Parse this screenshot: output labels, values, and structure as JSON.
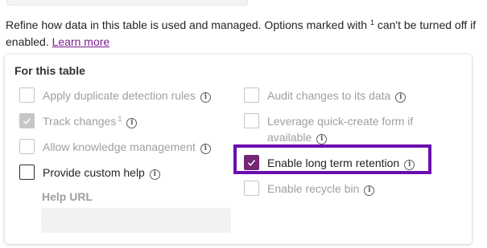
{
  "description": {
    "text_before": "Refine how data in this table is used and managed. Options marked with ",
    "superscript": "1",
    "text_after": " can't be turned off if enabled. ",
    "link_label": "Learn more"
  },
  "section": {
    "title": "For this table",
    "left_options": [
      {
        "label": "Apply duplicate detection rules",
        "checked": false,
        "disabled": true,
        "superscript": ""
      },
      {
        "label": "Track changes",
        "checked": true,
        "disabled": true,
        "superscript": "1"
      },
      {
        "label": "Allow knowledge management",
        "checked": false,
        "disabled": true,
        "superscript": ""
      },
      {
        "label": "Provide custom help",
        "checked": false,
        "disabled": false,
        "superscript": ""
      }
    ],
    "right_options": [
      {
        "label": "Audit changes to its data",
        "checked": false,
        "disabled": true
      },
      {
        "label": "Leverage quick-create form if available",
        "checked": false,
        "disabled": true
      },
      {
        "label": "Enable long term retention",
        "checked": true,
        "disabled": false
      },
      {
        "label": "Enable recycle bin",
        "checked": false,
        "disabled": true
      }
    ],
    "help_url": {
      "label": "Help URL",
      "value": ""
    }
  },
  "colors": {
    "accent": "#742774",
    "highlight": "#6a0dad",
    "link": "#7a1f8f"
  },
  "icons": {
    "info": "info-icon",
    "check": "checkmark-icon"
  }
}
